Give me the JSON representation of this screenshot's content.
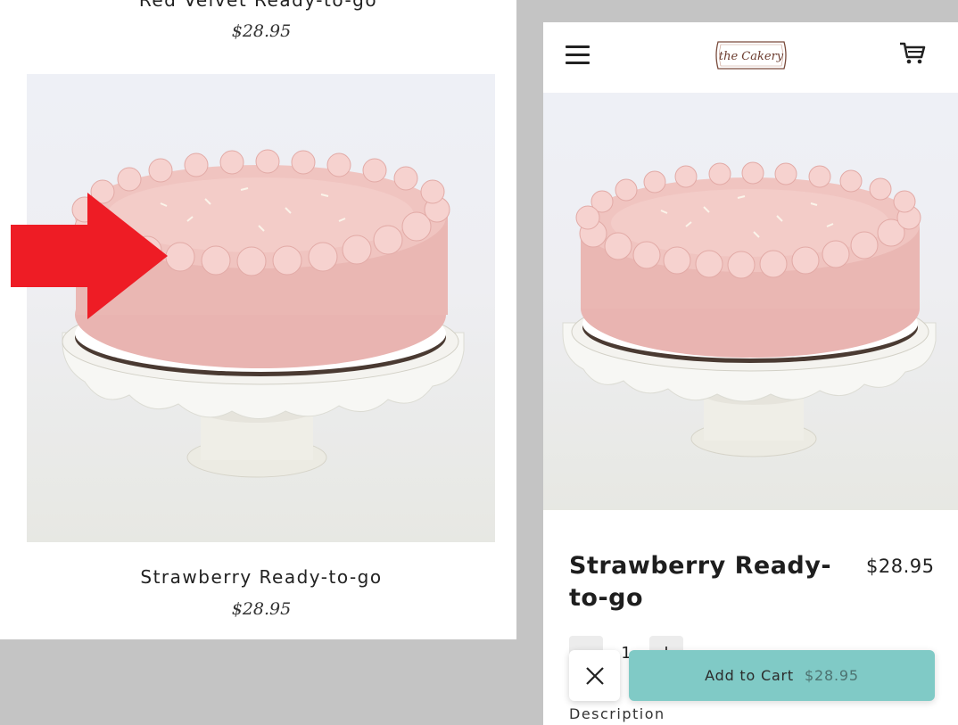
{
  "listing": {
    "prev_item_title": "Red Velvet Ready-to-go",
    "prev_item_price": "$28.95",
    "item_title": "Strawberry Ready-to-go",
    "item_price": "$28.95"
  },
  "arrow_color": "#ee1c25",
  "mobile": {
    "header": {
      "menu_icon": "hamburger-menu-icon",
      "logo_text": "the Cakery",
      "cart_icon": "shopping-cart-icon"
    },
    "product": {
      "title": "Strawberry Ready-to-go",
      "price": "$28.95"
    },
    "quantity": {
      "decrement": "−",
      "value": "1",
      "increment": "+"
    },
    "description_label": "Description",
    "action_bar": {
      "close_icon": "close-icon",
      "add_to_cart_label": "Add to Cart",
      "add_to_cart_price": "$28.95",
      "accent_color": "#80cac6"
    }
  }
}
